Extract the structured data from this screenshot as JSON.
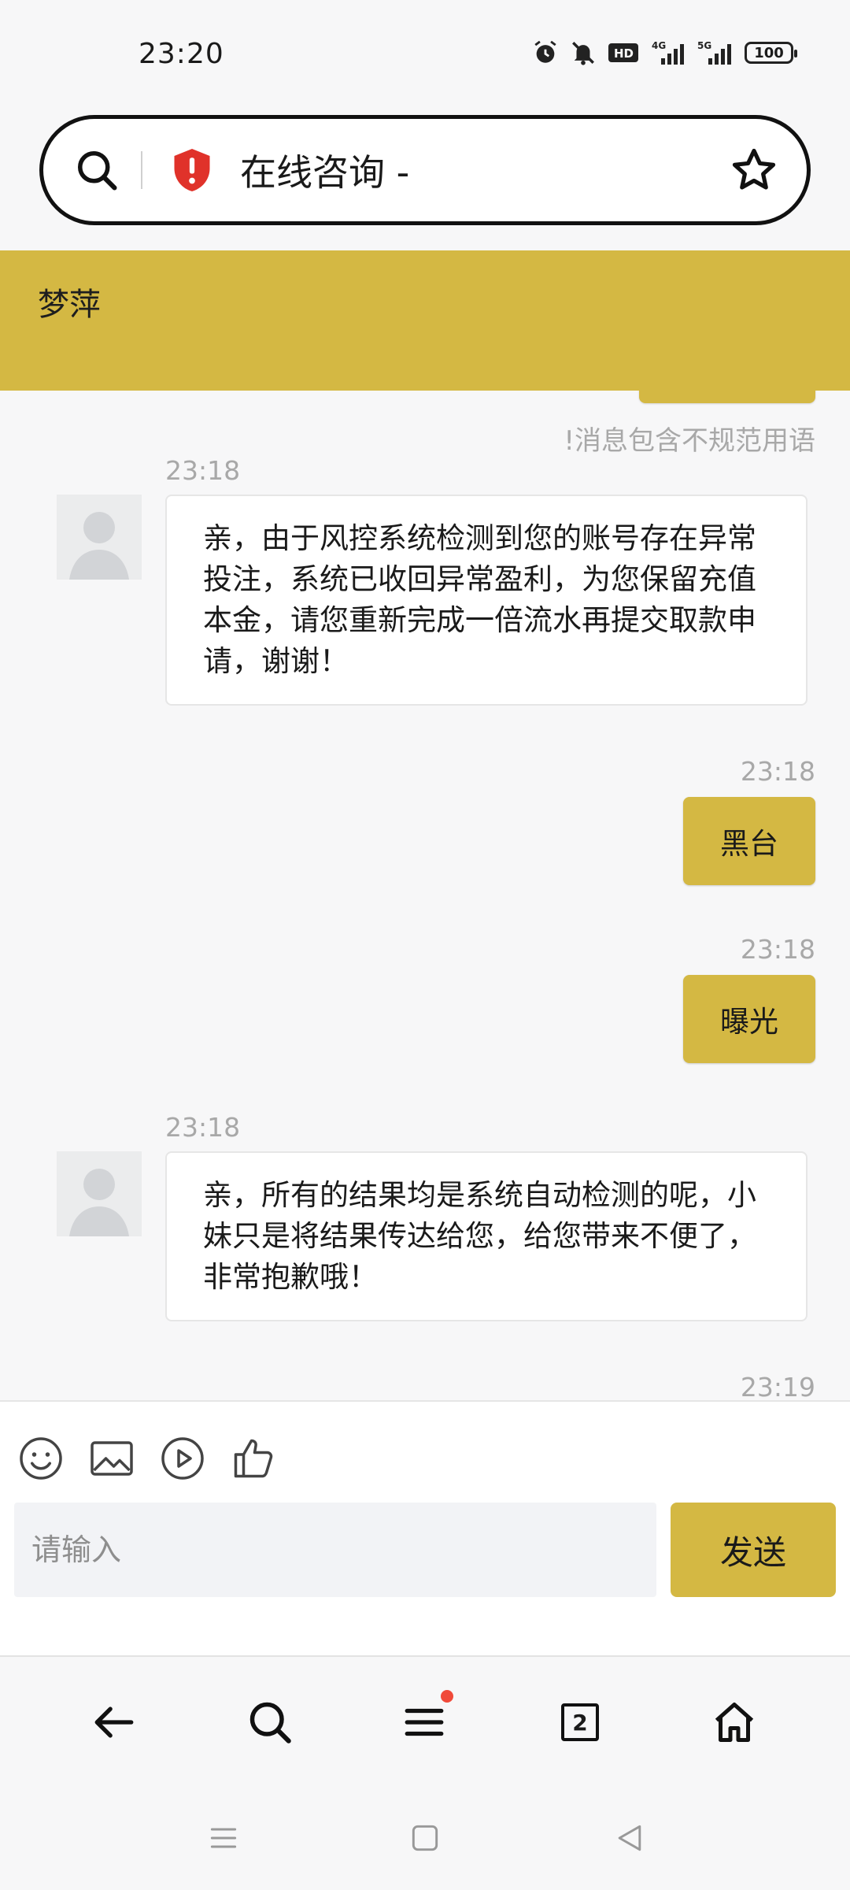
{
  "status_bar": {
    "time": "23:20",
    "battery": "100",
    "hd_label": "HD",
    "net_4g": "4G",
    "net_5g": "5G"
  },
  "url_bar": {
    "page_title": "在线咨询 -"
  },
  "header": {
    "agent_name": "梦萍"
  },
  "chat": {
    "warning": "!消息包含不规范用语",
    "messages": [
      {
        "side": "in",
        "time": "23:18",
        "text": "亲，由于风控系统检测到您的账号存在异常投注，系统已收回异常盈利，为您保留充值本金，请您重新完成一倍流水再提交取款申请，谢谢！"
      },
      {
        "side": "out",
        "time": "23:18",
        "text": "黑台"
      },
      {
        "side": "out",
        "time": "23:18",
        "text": "曝光"
      },
      {
        "side": "in",
        "time": "23:18",
        "text": "亲，所有的结果均是系统自动检测的呢，小妹只是将结果传达给您，给您带来不便了，非常抱歉哦！"
      },
      {
        "side": "out",
        "time": "23:19",
        "text": ""
      }
    ]
  },
  "composer": {
    "placeholder": "请输入",
    "send_label": "发送",
    "tools": [
      "emoji-icon",
      "image-icon",
      "video-icon",
      "like-icon"
    ]
  },
  "browser_nav": {
    "tab_count": "2"
  },
  "colors": {
    "accent": "#d4b843",
    "background": "#f7f7f8",
    "timestamp": "#a8a8a8"
  }
}
